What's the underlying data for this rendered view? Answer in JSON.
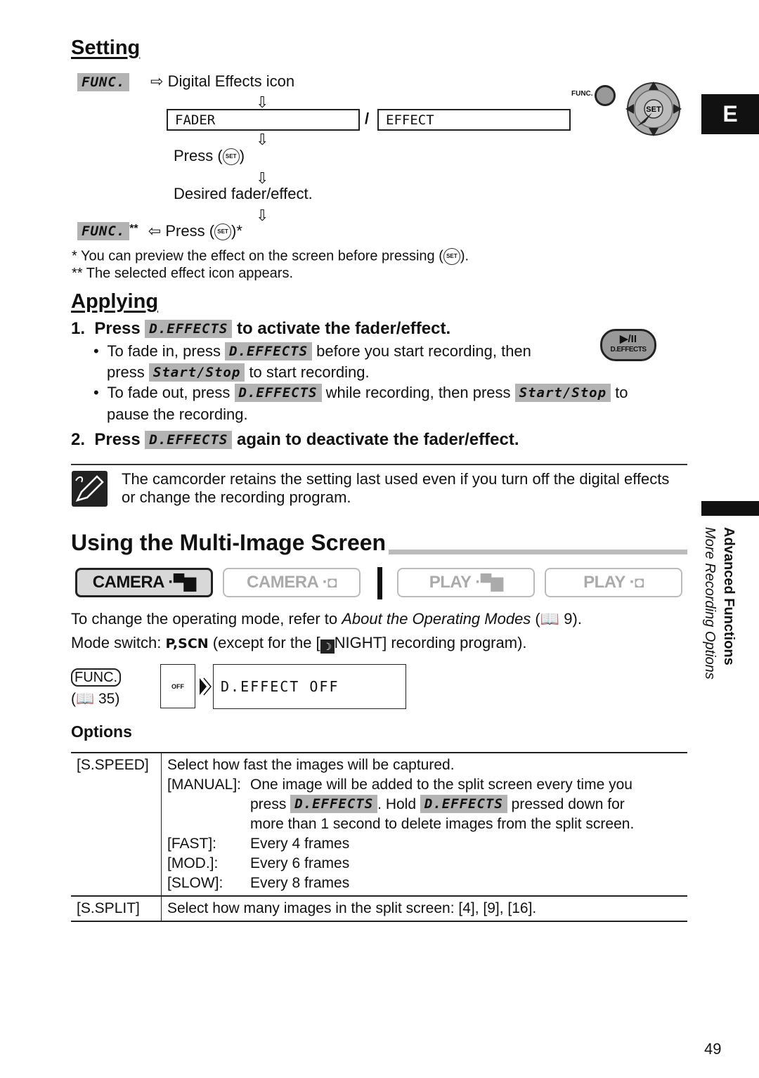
{
  "setting": {
    "heading": "Setting",
    "func_key": "FUNC.",
    "step1": "Digital Effects icon",
    "lcd_left": "FADER",
    "separator": "/",
    "lcd_right": "EFFECT",
    "press_text": "Press (",
    "press_close": ")",
    "set_label": "SET",
    "desired": "Desired fader/effect.",
    "func_key_final": "FUNC.",
    "func_final_mark": "**",
    "press_final_close": ")*",
    "func_button_label": "FUNC.",
    "footnote1": "*  You can preview the effect on the screen before pressing  (",
    "footnote1_end": ").",
    "footnote2": "** The selected effect icon appears."
  },
  "language_tab": "E",
  "applying": {
    "heading": "Applying",
    "step1": {
      "num": "1.",
      "pre": "Press",
      "key": "D.EFFECTS",
      "post": "to activate the fader/effect."
    },
    "bullet1": {
      "pre": "To fade in, press",
      "key": "D.EFFECTS",
      "mid": "before you start recording, then",
      "line2_pre": "press",
      "key2": "Start/Stop",
      "line2_post": "to start recording."
    },
    "bullet2": {
      "pre": "To fade out, press",
      "key": "D.EFFECTS",
      "mid": "while recording, then press",
      "key2": "Start/Stop",
      "post": "to",
      "line2": "pause the recording."
    },
    "step2": {
      "num": "2.",
      "pre": "Press",
      "key": "D.EFFECTS",
      "post": "again to deactivate the fader/effect."
    },
    "button_icon_symbol": "▶/II",
    "button_icon_label": "D.EFFECTS"
  },
  "note": {
    "line1": "The camcorder retains the setting last used even if you turn off the digital effects",
    "line2": "or change the recording program."
  },
  "multi_image": {
    "heading": "Using the Multi-Image Screen",
    "modes": [
      {
        "label": "CAMERA · ",
        "icon": "movie",
        "active": true
      },
      {
        "label": "CAMERA · ",
        "icon": "photo",
        "active": false
      },
      {
        "label": "PLAY · ",
        "icon": "movie",
        "active": false
      },
      {
        "label": "PLAY · ",
        "icon": "photo",
        "active": false
      }
    ],
    "ref_pre": "To change the operating mode, refer to ",
    "ref_italic": "About the Operating Modes",
    "ref_post": " (",
    "ref_page": " 9).",
    "mode_switch_pre": "Mode switch: ",
    "mode_switch_value": "P,SCN",
    "mode_switch_mid": " (except for the [",
    "mode_switch_post": "NIGHT] recording program).",
    "func_label": "FUNC.",
    "func_ref_pre": "(",
    "func_ref_page": " 35)",
    "icon_text": "OFF",
    "lcd_value": "D.EFFECT OFF"
  },
  "options": {
    "heading": "Options",
    "rows": [
      {
        "label": "[S.SPEED]",
        "desc": "Select how fast the images will be captured.",
        "manual_key": "[MANUAL]:",
        "manual_line1": "One image will be added to the split screen every time you",
        "manual_line2_pre": "press",
        "manual_key1": "D.EFFECTS",
        "manual_line2_mid": ". Hold",
        "manual_key2": "D.EFFECTS",
        "manual_line2_post": "pressed down for",
        "manual_line3": "more than 1 second to delete images from the split screen.",
        "speeds": [
          {
            "key": "[FAST]:",
            "value": "Every 4 frames"
          },
          {
            "key": "[MOD.]:",
            "value": "Every 6 frames"
          },
          {
            "key": "[SLOW]:",
            "value": "Every 8 frames"
          }
        ]
      },
      {
        "label": "[S.SPLIT]",
        "desc": "Select how many images in the split screen: [4], [9], [16]."
      }
    ]
  },
  "side": {
    "section": "Advanced Functions",
    "subsection": "More Recording Options"
  },
  "page_number": "49"
}
